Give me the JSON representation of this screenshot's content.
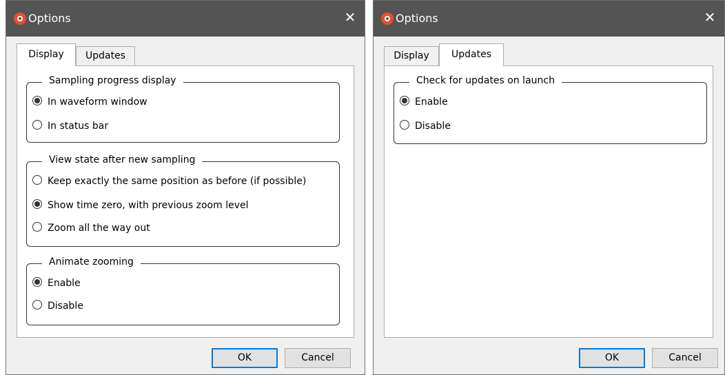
{
  "dialogs": [
    {
      "title": "Options",
      "close_glyph": "✕",
      "tabs": [
        "Display",
        "Updates"
      ],
      "active_tab": "Display",
      "groups": [
        {
          "legend": "Sampling progress display",
          "options": [
            {
              "label": "In waveform window",
              "checked": true
            },
            {
              "label": "In status bar",
              "checked": false
            }
          ]
        },
        {
          "legend": "View state after new sampling",
          "options": [
            {
              "label": "Keep exactly the same position as before (if possible)",
              "checked": false
            },
            {
              "label": "Show time zero, with previous zoom level",
              "checked": true
            },
            {
              "label": "Zoom all the way out",
              "checked": false
            }
          ]
        },
        {
          "legend": "Animate zooming",
          "options": [
            {
              "label": "Enable",
              "checked": true
            },
            {
              "label": "Disable",
              "checked": false
            }
          ]
        }
      ],
      "ok_label": "OK",
      "cancel_label": "Cancel"
    },
    {
      "title": "Options",
      "close_glyph": "✕",
      "tabs": [
        "Display",
        "Updates"
      ],
      "active_tab": "Updates",
      "groups": [
        {
          "legend": "Check for updates on launch",
          "options": [
            {
              "label": "Enable",
              "checked": true
            },
            {
              "label": "Disable",
              "checked": false
            }
          ]
        }
      ],
      "ok_label": "OK",
      "cancel_label": "Cancel"
    }
  ],
  "icons": {
    "app": "app-logo-icon",
    "close": "close-icon",
    "radio_on": "radio-selected-icon",
    "radio_off": "radio-unselected-icon"
  },
  "colors": {
    "titlebar": "#545454",
    "app_icon": "#e8502a",
    "default_button_border": "#0078d7"
  }
}
